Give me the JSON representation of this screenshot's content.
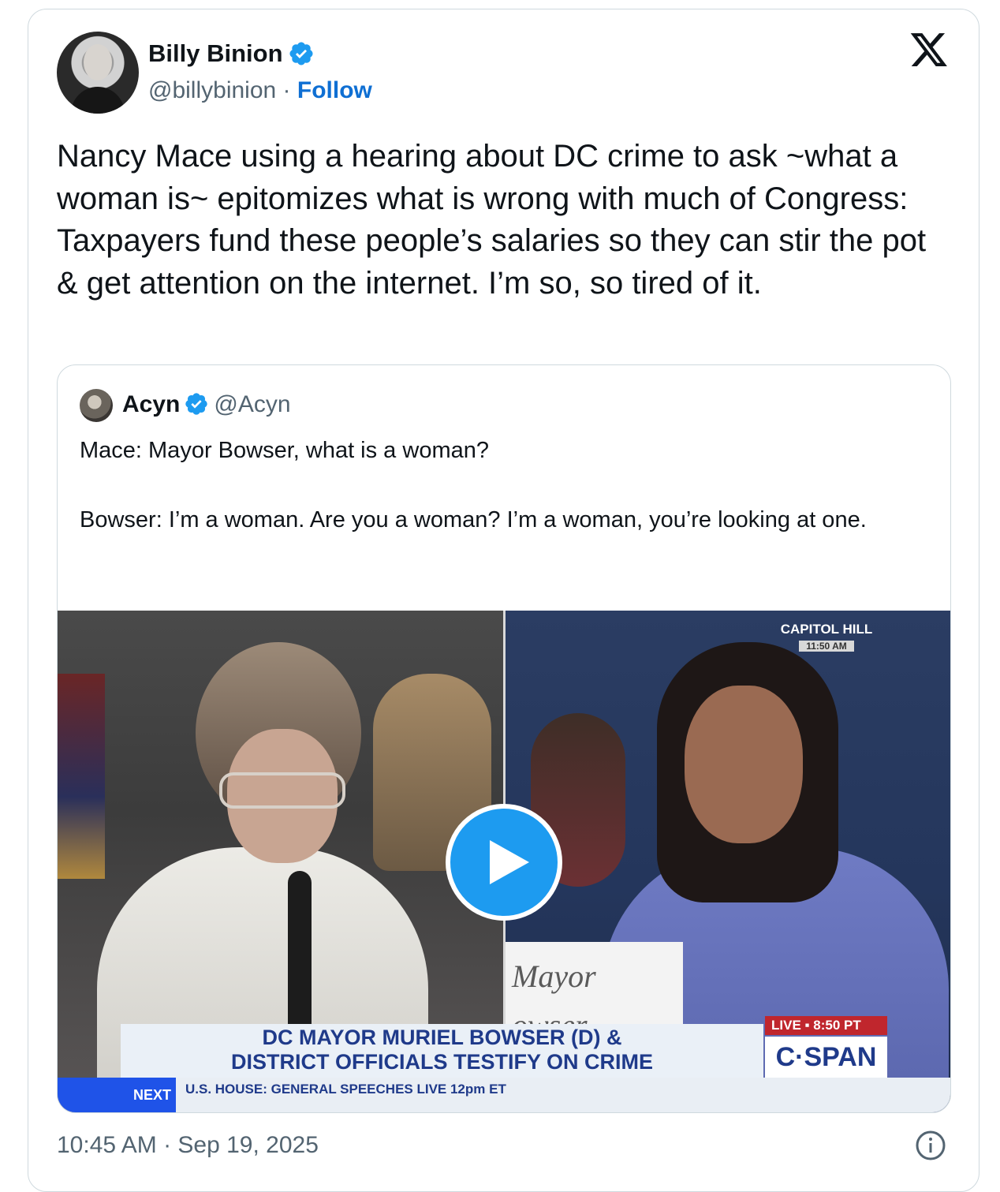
{
  "author": {
    "name": "Billy Binion",
    "handle": "@billybinion",
    "separator": "·",
    "follow_label": "Follow"
  },
  "tweet": {
    "text": "Nancy Mace using a hearing about DC crime to ask ~what a woman is~ epitomizes what is wrong with much of Congress: Taxpayers fund these people’s salaries so they can stir the pot & get attention on the internet. I’m so, so tired of it."
  },
  "quoted": {
    "name": "Acyn",
    "handle": "@Acyn",
    "text": "Mace: Mayor Bowser, what is a woman?\n\nBowser: I’m a woman. Are you a woman? I’m a woman, you’re looking at one."
  },
  "video": {
    "bug_title": "CAPITOL HILL",
    "bug_time": "11:50 AM",
    "nameplate_line1": "Mayor",
    "nameplate_line2": "owser",
    "lower_third": "DC MAYOR MURIEL BOWSER (D) &\nDISTRICT OFFICIALS TESTIFY ON CRIME",
    "live_label": "LIVE ▪ 8:50 PT",
    "network": "C·SPAN",
    "ticker_next": "NEXT",
    "ticker_text": "U.S. HOUSE: GENERAL SPEECHES  LIVE 12pm ET"
  },
  "footer": {
    "timestamp": "10:45 AM · Sep 19, 2025"
  },
  "icons": {
    "verified": "verified-badge-icon",
    "x_logo": "x-logo-icon",
    "play": "play-icon",
    "info": "info-icon"
  },
  "colors": {
    "accent": "#1d9bf0",
    "follow": "#0f6fd3",
    "secondary_text": "#536471",
    "border": "#cfd9de"
  }
}
